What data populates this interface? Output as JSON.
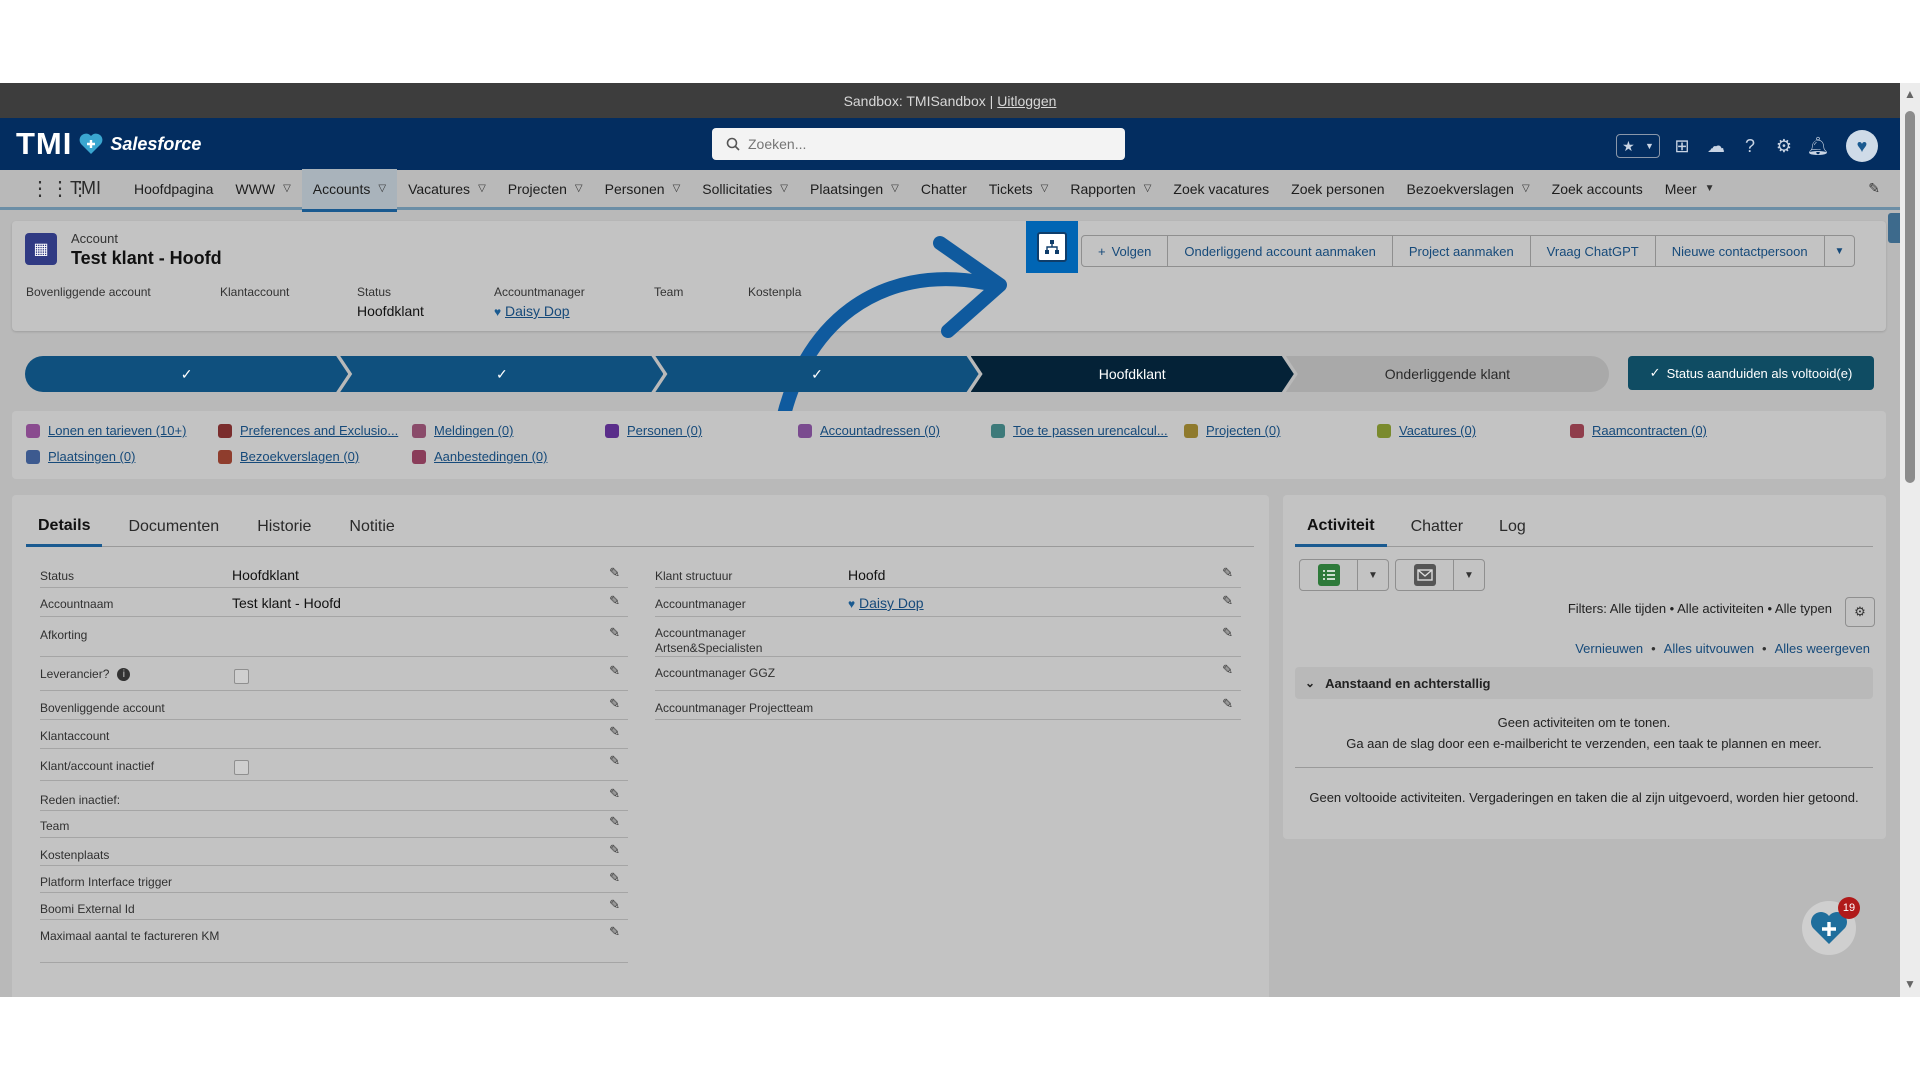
{
  "sandbox": {
    "text": "Sandbox: TMISandbox |",
    "logout": "Uitloggen"
  },
  "header": {
    "logo_text": "TMI",
    "logo_brand": "Salesforce",
    "search_placeholder": "Zoeken..."
  },
  "nav": {
    "app_name": "TMI",
    "items": [
      {
        "label": "Hoofdpagina",
        "chevron": false
      },
      {
        "label": "WWW",
        "chevron": true
      },
      {
        "label": "Accounts",
        "chevron": true,
        "active": true
      },
      {
        "label": "Vacatures",
        "chevron": true
      },
      {
        "label": "Projecten",
        "chevron": true
      },
      {
        "label": "Personen",
        "chevron": true
      },
      {
        "label": "Sollicitaties",
        "chevron": true
      },
      {
        "label": "Plaatsingen",
        "chevron": true
      },
      {
        "label": "Chatter",
        "chevron": false
      },
      {
        "label": "Tickets",
        "chevron": true
      },
      {
        "label": "Rapporten",
        "chevron": true
      },
      {
        "label": "Zoek vacatures",
        "chevron": false
      },
      {
        "label": "Zoek personen",
        "chevron": false
      },
      {
        "label": "Bezoekverslagen",
        "chevron": true
      },
      {
        "label": "Zoek accounts",
        "chevron": false
      },
      {
        "label": "Meer",
        "chevron": true
      }
    ]
  },
  "record": {
    "type": "Account",
    "name": "Test klant - Hoofd",
    "actions": {
      "follow": "Volgen",
      "child_account": "Onderliggend account aanmaken",
      "project": "Project aanmaken",
      "chatgpt": "Vraag ChatGPT",
      "new_contact": "Nieuwe contactpersoon"
    },
    "fields": [
      {
        "label": "Bovenliggende account",
        "value": ""
      },
      {
        "label": "Klantaccount",
        "value": ""
      },
      {
        "label": "Status",
        "value": "Hoofdklant"
      },
      {
        "label": "Accountmanager",
        "value": "Daisy Dop"
      },
      {
        "label": "Team",
        "value": ""
      },
      {
        "label": "Kostenpla",
        "value": ""
      }
    ]
  },
  "path": {
    "current": "Hoofdklant",
    "next": "Onderliggende klant",
    "complete_button": "Status aanduiden als voltooid(e)"
  },
  "related": [
    {
      "label": "Lonen en tarieven (10+)",
      "color": "#8a4b8f"
    },
    {
      "label": "Preferences and Exclusio...",
      "color": "#7a2d2d"
    },
    {
      "label": "Meldingen (0)",
      "color": "#8a4b6a"
    },
    {
      "label": "Personen (0)",
      "color": "#5a2d8a"
    },
    {
      "label": "Accountadressen (0)",
      "color": "#7a4b8f"
    },
    {
      "label": "Toe te passen urencalcul...",
      "color": "#3d7a7a"
    },
    {
      "label": "Projecten (0)",
      "color": "#8f7a2d"
    },
    {
      "label": "Vacatures (0)",
      "color": "#7a8a2d"
    },
    {
      "label": "Raamcontracten (0)",
      "color": "#8f3d4b"
    },
    {
      "label": "Plaatsingen (0)",
      "color": "#3d5a8f"
    },
    {
      "label": "Bezoekverslagen (0)",
      "color": "#8f3d2d"
    },
    {
      "label": "Aanbestedingen (0)",
      "color": "#8a3d5a"
    }
  ],
  "details": {
    "tabs": [
      "Details",
      "Documenten",
      "Historie",
      "Notitie"
    ],
    "left": [
      {
        "label": "Status",
        "value": "Hoofdklant"
      },
      {
        "label": "Accountnaam",
        "value": "Test klant - Hoofd"
      },
      {
        "label": "Afkorting",
        "value": ""
      },
      {
        "label": "Leverancier?",
        "value": ""
      },
      {
        "label": "Bovenliggende account",
        "value": ""
      },
      {
        "label": "Klantaccount",
        "value": ""
      },
      {
        "label": "Klant/account inactief",
        "value": ""
      },
      {
        "label": "Reden inactief:",
        "value": ""
      },
      {
        "label": "Team",
        "value": ""
      },
      {
        "label": "Kostenplaats",
        "value": ""
      },
      {
        "label": "Platform Interface trigger",
        "value": ""
      },
      {
        "label": "Boomi External Id",
        "value": ""
      },
      {
        "label": "Maximaal aantal te factureren KM",
        "value": ""
      }
    ],
    "right": [
      {
        "label": "Klant structuur",
        "value": "Hoofd"
      },
      {
        "label": "Accountmanager",
        "value": "Daisy Dop"
      },
      {
        "label": "Accountmanager Artsen&Specialisten",
        "value": ""
      },
      {
        "label": "Accountmanager GGZ",
        "value": ""
      },
      {
        "label": "Accountmanager Projectteam",
        "value": ""
      }
    ]
  },
  "activity": {
    "tabs": [
      "Activiteit",
      "Chatter",
      "Log"
    ],
    "filters": "Filters: Alle tijden • Alle activiteiten • Alle typen",
    "links": [
      "Vernieuwen",
      "Alles uitvouwen",
      "Alles weergeven"
    ],
    "section": "Aanstaand en achterstallig",
    "empty1": "Geen activiteiten om te tonen.",
    "empty2": "Ga aan de slag door een e-mailbericht te verzenden, een taak te plannen en meer.",
    "empty3": "Geen voltooide activiteiten. Vergaderingen en taken die al zijn uitgevoerd, worden hier getoond."
  },
  "fab_badge": "19"
}
